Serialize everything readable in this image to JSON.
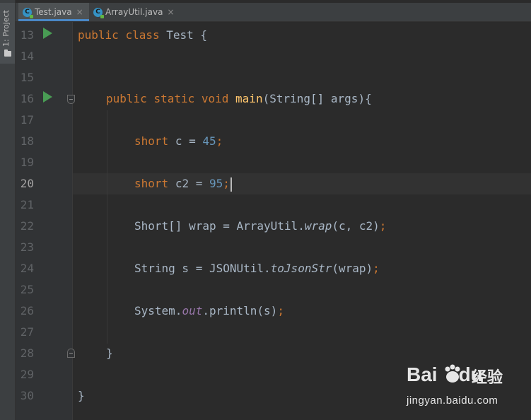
{
  "sidebar": {
    "project_label": "1: Project"
  },
  "tabs": [
    {
      "label": "Test.java",
      "active": true,
      "icon": "java-class-icon"
    },
    {
      "label": "ArrayUtil.java",
      "active": false,
      "icon": "java-class-icon"
    }
  ],
  "tab_close_glyph": "×",
  "class_icon_letter": "C",
  "editor": {
    "current_line": 20,
    "line_numbers": [
      "13",
      "14",
      "15",
      "16",
      "17",
      "18",
      "19",
      "20",
      "21",
      "22",
      "23",
      "24",
      "25",
      "26",
      "27",
      "28",
      "29",
      "30"
    ]
  },
  "code": {
    "l13": {
      "kw1": "public",
      "kw2": "class",
      "name": "Test {"
    },
    "l16": {
      "kw1": "public",
      "kw2": "static",
      "kw3": "void",
      "method": "main",
      "params": "(String[] args){"
    },
    "l18": {
      "type": "short",
      "rest": "c = ",
      "num": "45",
      "semi": ";"
    },
    "l20": {
      "type": "short",
      "rest": "c2 = ",
      "num": "95",
      "semi": ";"
    },
    "l22": {
      "a": "Short[] wrap = ArrayUtil.",
      "call": "wrap",
      "b": "(c, c2)",
      "semi": ";"
    },
    "l24": {
      "a": "String s = JSONUtil.",
      "call": "toJsonStr",
      "b": "(wrap)",
      "semi": ";"
    },
    "l26": {
      "a": "System.",
      "field": "out",
      "b": ".println(s)",
      "semi": ";"
    },
    "l28": {
      "text": "}"
    },
    "l30": {
      "text": "}"
    }
  },
  "colors": {
    "background": "#2b2b2b",
    "keyword": "#cc7832",
    "number": "#6897bb",
    "method_decl": "#ffc66d",
    "field": "#9876aa",
    "run_icon": "#499c54"
  },
  "watermark": {
    "brand": "Bai",
    "brand_tail": "du",
    "cn": "经验",
    "url": "jingyan.baidu.com"
  }
}
